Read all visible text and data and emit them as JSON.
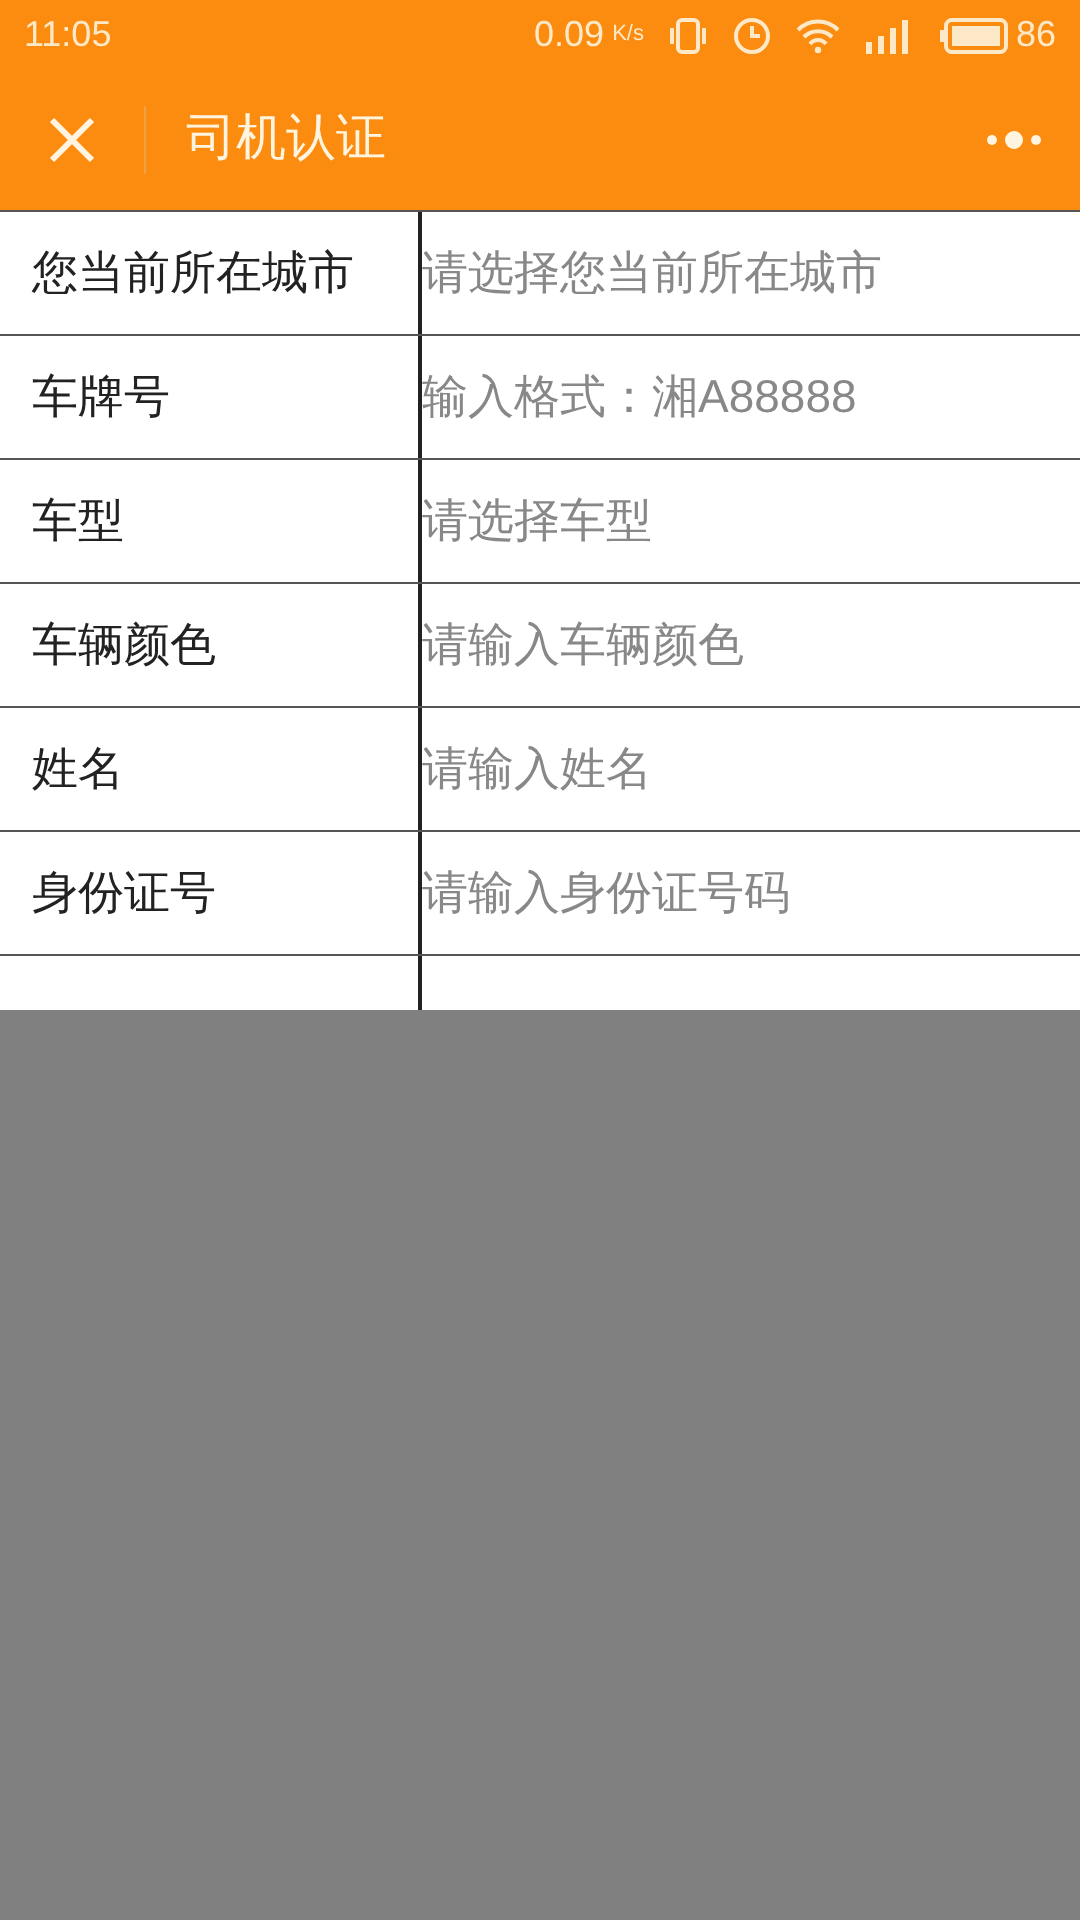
{
  "status_bar": {
    "time": "11:05",
    "speed": "0.09",
    "speed_unit": "K/s",
    "battery": "86"
  },
  "header": {
    "title": "司机认证"
  },
  "form": {
    "rows": [
      {
        "label": "您当前所在城市",
        "placeholder": "请选择您当前所在城市"
      },
      {
        "label": "车牌号",
        "placeholder": "输入格式：湘A88888"
      },
      {
        "label": "车型",
        "placeholder": "请选择车型"
      },
      {
        "label": "车辆颜色",
        "placeholder": "请输入车辆颜色"
      },
      {
        "label": "姓名",
        "placeholder": "请输入姓名"
      },
      {
        "label": "身份证号",
        "placeholder": "请输入身份证号码"
      }
    ]
  }
}
